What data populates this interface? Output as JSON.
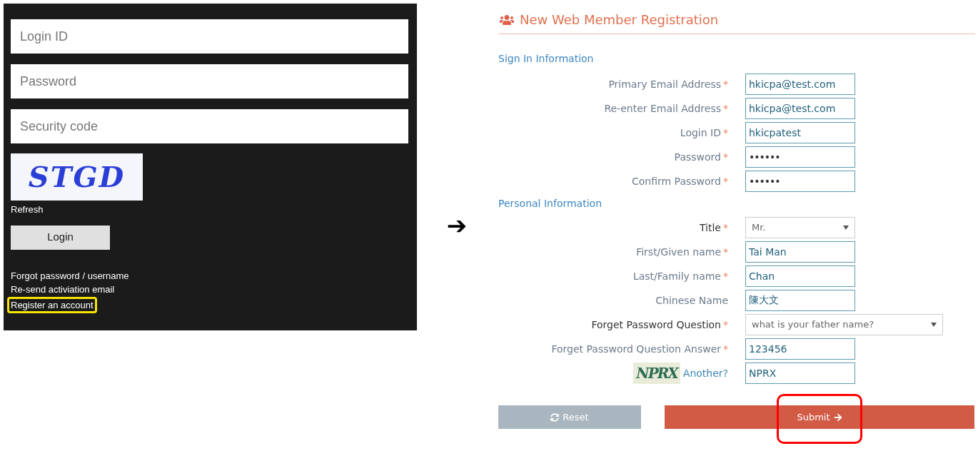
{
  "login_panel": {
    "fields": [
      {
        "placeholder": "Login ID"
      },
      {
        "placeholder": "Password"
      },
      {
        "placeholder": "Security code"
      }
    ],
    "captcha_text": "STGD",
    "refresh": "Refresh",
    "login_button": "Login",
    "links": [
      {
        "label": "Forgot password / username",
        "highlighted": false
      },
      {
        "label": "Re-send activiation email",
        "highlighted": false
      },
      {
        "label": "Register an account",
        "highlighted": true
      }
    ]
  },
  "arrow": "➔",
  "registration": {
    "title": "New Web Member Registration",
    "sections": [
      {
        "heading": "Sign In Information",
        "fields": [
          {
            "kind": "text",
            "label": "Primary Email Address",
            "required": true,
            "value": "hkicpa@test.com"
          },
          {
            "kind": "text",
            "label": "Re-enter Email Address",
            "required": true,
            "value": "hkicpa@test.com"
          },
          {
            "kind": "text",
            "label": "Login ID",
            "required": true,
            "value": "hkicpatest"
          },
          {
            "kind": "password",
            "label": "Password",
            "required": true,
            "value": "••••••"
          },
          {
            "kind": "password",
            "label": "Confirm Password",
            "required": true,
            "value": "••••••"
          }
        ]
      },
      {
        "heading": "Personal Information",
        "fields": [
          {
            "kind": "select",
            "label": "Title",
            "required": true,
            "value": "Mr.",
            "wide": false
          },
          {
            "kind": "text",
            "label": "First/Given name",
            "required": true,
            "value": "Tai Man"
          },
          {
            "kind": "text",
            "label": "Last/Family name",
            "required": true,
            "value": "Chan"
          },
          {
            "kind": "text",
            "label": "Chinese Name",
            "required": false,
            "value": "陳大文"
          },
          {
            "kind": "select",
            "label": "Forget Password Question",
            "required": true,
            "value": "what is your father name?",
            "wide": true
          },
          {
            "kind": "text",
            "label": "Forget Password Question Answer",
            "required": true,
            "value": "123456"
          },
          {
            "kind": "captcha",
            "captcha_text": "NPRX",
            "link": "Another?",
            "value": "NPRX"
          }
        ]
      }
    ],
    "required_mark": "*",
    "buttons": [
      {
        "kind": "reset",
        "label": "Reset",
        "highlighted": false
      },
      {
        "kind": "submit",
        "label": "Submit",
        "highlighted": true
      }
    ]
  }
}
